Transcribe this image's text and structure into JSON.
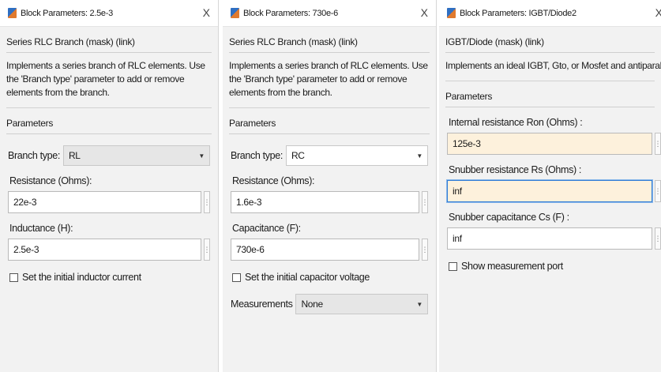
{
  "panel1": {
    "title": "Block Parameters: 2.5e-3",
    "close": "X",
    "header": "Series RLC Branch (mask) (link)",
    "desc": "Implements a series branch of RLC elements. Use the 'Branch type' parameter to add or remove elements from the branch.",
    "params": "Parameters",
    "branch_label": "Branch type:",
    "branch_value": "RL",
    "resistance_label": "Resistance (Ohms):",
    "resistance_value": "22e-3",
    "inductance_label": "Inductance (H):",
    "inductance_value": "2.5e-3",
    "checkbox_label": "Set the initial inductor current"
  },
  "panel2": {
    "title": "Block Parameters: 730e-6",
    "close": "X",
    "header": "Series RLC Branch (mask) (link)",
    "desc": "Implements a series branch of RLC elements. Use the 'Branch type' parameter to add or remove elements from the branch.",
    "params": "Parameters",
    "branch_label": "Branch type:",
    "branch_value": "RC",
    "resistance_label": "Resistance (Ohms):",
    "resistance_value": "1.6e-3",
    "capacitance_label": "Capacitance (F):",
    "capacitance_value": "730e-6",
    "checkbox_label": "Set the initial capacitor voltage",
    "measurements_label": "Measurements",
    "measurements_value": "None"
  },
  "panel3": {
    "title": "Block Parameters: IGBT/Diode2",
    "close": "X",
    "header": "IGBT/Diode (mask) (link)",
    "desc": "Implements an ideal  IGBT, Gto, or Mosfet and antiparallel diode.",
    "params": "Parameters",
    "ron_label": "Internal resistance Ron (Ohms) :",
    "ron_value": "125e-3",
    "rs_label": "Snubber resistance Rs (Ohms) :",
    "rs_value": "inf",
    "cs_label": "Snubber capacitance Cs (F) :",
    "cs_value": "inf",
    "checkbox_label": "Show measurement port"
  },
  "icons": {
    "app": "simulink-block-icon",
    "dropdown": "chevron-down-icon",
    "more": "ellipsis-vertical-icon"
  }
}
